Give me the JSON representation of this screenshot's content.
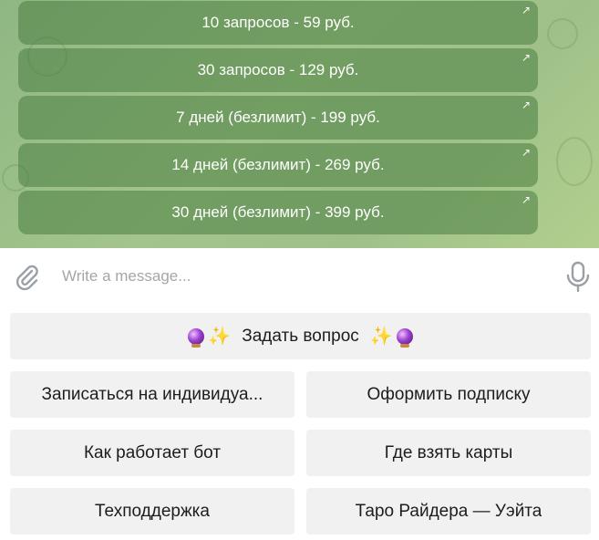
{
  "inline_buttons": [
    {
      "label": "10 запросов - 59 руб."
    },
    {
      "label": "30 запросов - 129 руб."
    },
    {
      "label": "7 дней (безлимит) - 199 руб."
    },
    {
      "label": "14 дней (безлимит) - 269 руб."
    },
    {
      "label": "30 дней (безлимит) - 399 руб."
    }
  ],
  "input": {
    "placeholder": "Write a message..."
  },
  "keyboard": {
    "ask": {
      "label": "Задать вопрос",
      "left_icons": [
        "crystal-ball-icon",
        "sparkles-icon"
      ],
      "right_icons": [
        "sparkles-icon",
        "crystal-ball-icon"
      ]
    },
    "rows": [
      [
        "Записаться на индивидуа...",
        "Оформить подписку"
      ],
      [
        "Как работает бот",
        "Где взять карты"
      ],
      [
        "Техподдержка",
        "Таро Райдера — Уэйта"
      ]
    ]
  },
  "colors": {
    "chat_bg": "#9fc189",
    "inline_button_bg": "rgba(75,125,65,0.55)",
    "keyboard_button_bg": "#f1f1f1"
  }
}
